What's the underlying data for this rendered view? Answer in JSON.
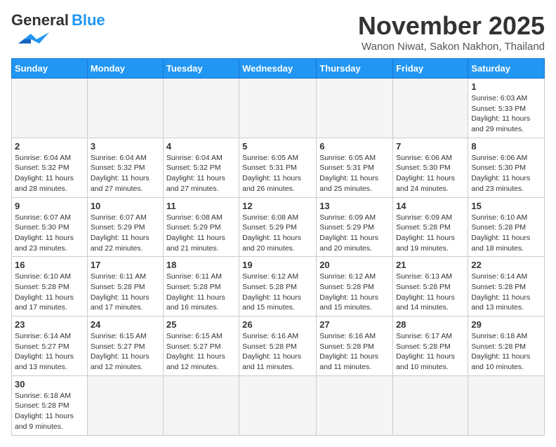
{
  "header": {
    "logo_general": "General",
    "logo_blue": "Blue",
    "month_title": "November 2025",
    "location": "Wanon Niwat, Sakon Nakhon, Thailand"
  },
  "weekdays": [
    "Sunday",
    "Monday",
    "Tuesday",
    "Wednesday",
    "Thursday",
    "Friday",
    "Saturday"
  ],
  "weeks": [
    [
      {
        "day": "",
        "info": ""
      },
      {
        "day": "",
        "info": ""
      },
      {
        "day": "",
        "info": ""
      },
      {
        "day": "",
        "info": ""
      },
      {
        "day": "",
        "info": ""
      },
      {
        "day": "",
        "info": ""
      },
      {
        "day": "1",
        "info": "Sunrise: 6:03 AM\nSunset: 5:33 PM\nDaylight: 11 hours\nand 29 minutes."
      }
    ],
    [
      {
        "day": "2",
        "info": "Sunrise: 6:04 AM\nSunset: 5:32 PM\nDaylight: 11 hours\nand 28 minutes."
      },
      {
        "day": "3",
        "info": "Sunrise: 6:04 AM\nSunset: 5:32 PM\nDaylight: 11 hours\nand 27 minutes."
      },
      {
        "day": "4",
        "info": "Sunrise: 6:04 AM\nSunset: 5:32 PM\nDaylight: 11 hours\nand 27 minutes."
      },
      {
        "day": "5",
        "info": "Sunrise: 6:05 AM\nSunset: 5:31 PM\nDaylight: 11 hours\nand 26 minutes."
      },
      {
        "day": "6",
        "info": "Sunrise: 6:05 AM\nSunset: 5:31 PM\nDaylight: 11 hours\nand 25 minutes."
      },
      {
        "day": "7",
        "info": "Sunrise: 6:06 AM\nSunset: 5:30 PM\nDaylight: 11 hours\nand 24 minutes."
      },
      {
        "day": "8",
        "info": "Sunrise: 6:06 AM\nSunset: 5:30 PM\nDaylight: 11 hours\nand 23 minutes."
      }
    ],
    [
      {
        "day": "9",
        "info": "Sunrise: 6:07 AM\nSunset: 5:30 PM\nDaylight: 11 hours\nand 23 minutes."
      },
      {
        "day": "10",
        "info": "Sunrise: 6:07 AM\nSunset: 5:29 PM\nDaylight: 11 hours\nand 22 minutes."
      },
      {
        "day": "11",
        "info": "Sunrise: 6:08 AM\nSunset: 5:29 PM\nDaylight: 11 hours\nand 21 minutes."
      },
      {
        "day": "12",
        "info": "Sunrise: 6:08 AM\nSunset: 5:29 PM\nDaylight: 11 hours\nand 20 minutes."
      },
      {
        "day": "13",
        "info": "Sunrise: 6:09 AM\nSunset: 5:29 PM\nDaylight: 11 hours\nand 20 minutes."
      },
      {
        "day": "14",
        "info": "Sunrise: 6:09 AM\nSunset: 5:28 PM\nDaylight: 11 hours\nand 19 minutes."
      },
      {
        "day": "15",
        "info": "Sunrise: 6:10 AM\nSunset: 5:28 PM\nDaylight: 11 hours\nand 18 minutes."
      }
    ],
    [
      {
        "day": "16",
        "info": "Sunrise: 6:10 AM\nSunset: 5:28 PM\nDaylight: 11 hours\nand 17 minutes."
      },
      {
        "day": "17",
        "info": "Sunrise: 6:11 AM\nSunset: 5:28 PM\nDaylight: 11 hours\nand 17 minutes."
      },
      {
        "day": "18",
        "info": "Sunrise: 6:11 AM\nSunset: 5:28 PM\nDaylight: 11 hours\nand 16 minutes."
      },
      {
        "day": "19",
        "info": "Sunrise: 6:12 AM\nSunset: 5:28 PM\nDaylight: 11 hours\nand 15 minutes."
      },
      {
        "day": "20",
        "info": "Sunrise: 6:12 AM\nSunset: 5:28 PM\nDaylight: 11 hours\nand 15 minutes."
      },
      {
        "day": "21",
        "info": "Sunrise: 6:13 AM\nSunset: 5:28 PM\nDaylight: 11 hours\nand 14 minutes."
      },
      {
        "day": "22",
        "info": "Sunrise: 6:14 AM\nSunset: 5:28 PM\nDaylight: 11 hours\nand 13 minutes."
      }
    ],
    [
      {
        "day": "23",
        "info": "Sunrise: 6:14 AM\nSunset: 5:27 PM\nDaylight: 11 hours\nand 13 minutes."
      },
      {
        "day": "24",
        "info": "Sunrise: 6:15 AM\nSunset: 5:27 PM\nDaylight: 11 hours\nand 12 minutes."
      },
      {
        "day": "25",
        "info": "Sunrise: 6:15 AM\nSunset: 5:27 PM\nDaylight: 11 hours\nand 12 minutes."
      },
      {
        "day": "26",
        "info": "Sunrise: 6:16 AM\nSunset: 5:28 PM\nDaylight: 11 hours\nand 11 minutes."
      },
      {
        "day": "27",
        "info": "Sunrise: 6:16 AM\nSunset: 5:28 PM\nDaylight: 11 hours\nand 11 minutes."
      },
      {
        "day": "28",
        "info": "Sunrise: 6:17 AM\nSunset: 5:28 PM\nDaylight: 11 hours\nand 10 minutes."
      },
      {
        "day": "29",
        "info": "Sunrise: 6:18 AM\nSunset: 5:28 PM\nDaylight: 11 hours\nand 10 minutes."
      }
    ],
    [
      {
        "day": "30",
        "info": "Sunrise: 6:18 AM\nSunset: 5:28 PM\nDaylight: 11 hours\nand 9 minutes."
      },
      {
        "day": "",
        "info": ""
      },
      {
        "day": "",
        "info": ""
      },
      {
        "day": "",
        "info": ""
      },
      {
        "day": "",
        "info": ""
      },
      {
        "day": "",
        "info": ""
      },
      {
        "day": "",
        "info": ""
      }
    ]
  ]
}
